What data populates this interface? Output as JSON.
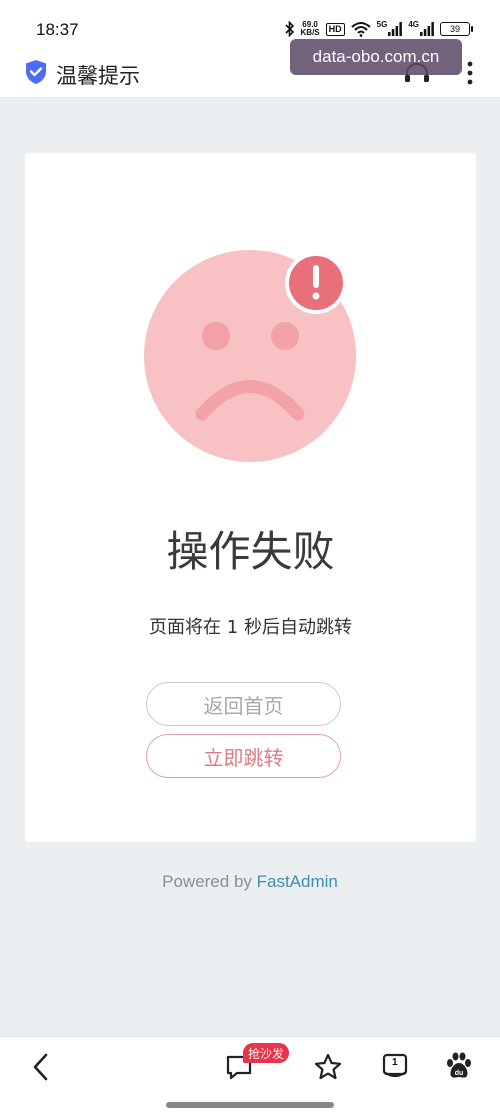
{
  "status_bar": {
    "time": "18:37",
    "net_speed_value": "69.0",
    "net_speed_unit": "KB/S",
    "hd_label": "HD",
    "net1_label": "5G",
    "net2_label": "4G",
    "battery": "39",
    "icons": [
      "bluetooth-icon",
      "wifi-icon",
      "signal-icon",
      "battery-icon"
    ]
  },
  "title_bar": {
    "title": "温馨提示",
    "icon": "shield-check-icon",
    "accent_color": "#4a6cf7"
  },
  "watermark": {
    "text": "data-obo.com.cn"
  },
  "result": {
    "title": "操作失败",
    "message": "页面将在 1 秒后自动跳转",
    "icon": "sad-face-icon",
    "face_color": "#f8c1c4",
    "feature_color": "#f2a2a8",
    "alert_color": "#e8707a"
  },
  "buttons": {
    "home_label": "返回首页",
    "jump_label": "立即跳转",
    "jump_color": "#de7c84"
  },
  "footer": {
    "powered_prefix": "Powered by ",
    "powered_link": "FastAdmin",
    "link_color": "#3f8eae"
  },
  "bottom_nav": {
    "badge_label": "抢沙发",
    "tab_count": "1",
    "items": [
      "back-icon",
      "comment-icon",
      "star-icon",
      "tabs-icon",
      "baidu-paw-icon"
    ]
  }
}
